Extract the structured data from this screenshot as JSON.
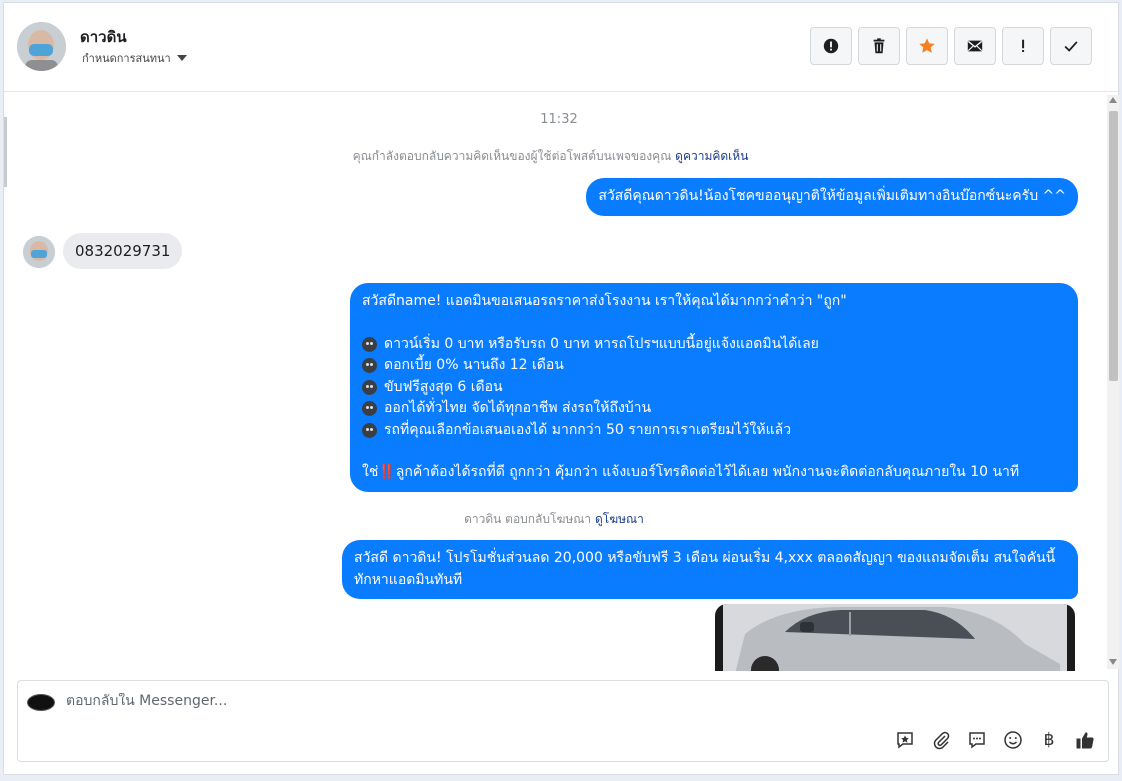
{
  "header": {
    "contact_name": "ดาวดิน",
    "assign_label": "กำหนดการสนทนา",
    "actions": [
      {
        "name": "report-icon"
      },
      {
        "name": "trash-icon"
      },
      {
        "name": "star-icon",
        "color": "#f48024"
      },
      {
        "name": "mail-icon"
      },
      {
        "name": "exclamation-icon"
      },
      {
        "name": "check-icon"
      }
    ]
  },
  "thread": {
    "timestamp": "11:32",
    "notice_1": {
      "text": "คุณกำลังตอบกลับความคิดเห็นของผู้ใช้ต่อโพสต์บนเพจของคุณ",
      "link": "ดูความคิดเห็น"
    },
    "msg_out_1": "สวัสดีคุณดาวดิน!น้องโชคขออนุญาติให้ข้อมูลเพิ่มเติมทางอินบ๊อกซ์นะครับ ^^",
    "msg_in_1": "0832029731",
    "msg_out_2": {
      "intro": "สวัสดีname! แอดมินขอเสนอรถราคาส่งโรงงาน เราให้คุณได้มากกว่าคำว่า \"ถูก\"",
      "items": [
        "ดาวน์เริ่ม 0 บาท หรือรับรถ 0 บาท หารถโปรฯแบบนี้อยู่แจ้งแอดมินได้เลย",
        "ดอกเบี้ย 0% นานถึง 12 เดือน",
        "ขับฟรีสูงสุด 6 เดือน",
        "ออกได้ทั่วไทย จัดได้ทุกอาชีพ ส่งรถให้ถึงบ้าน",
        "รถที่คุณเลือกข้อเสนอเองได้ มากกว่า 50 รายการเราเตรียมไว้ให้แล้ว"
      ],
      "closing_prefix": "ใช่",
      "closing_emoji": "‼️",
      "closing_text": "ลูกค้าต้องได้รถที่ดี ถูกกว่า คุ้มกว่า แจ้งเบอร์โทรติดต่อไว้ได้เลย พนักงานจะติดต่อกลับคุณภายใน 10 นาที"
    },
    "notice_2": {
      "text": "ดาวดิน ตอบกลับโฆษณา",
      "link": "ดูโฆษณา"
    },
    "msg_out_3": "สวัสดี ดาวดิน! โปรโมชั่นส่วนลด 20,000 หรือขับฟรี 3 เดือน ผ่อนเริ่ม 4,xxx ตลอดสัญญา ของแถมจัดเต็ม สนใจคันนี้ทักหาแอดมินทันที",
    "bubble_color": "#0a7cff"
  },
  "composer": {
    "placeholder": "ตอบกลับใน Messenger...",
    "tools": [
      "saved-reply-icon",
      "attachment-icon",
      "chat-icon",
      "emoji-icon",
      "baht-icon",
      "like-icon"
    ],
    "baht_symbol": "฿"
  }
}
